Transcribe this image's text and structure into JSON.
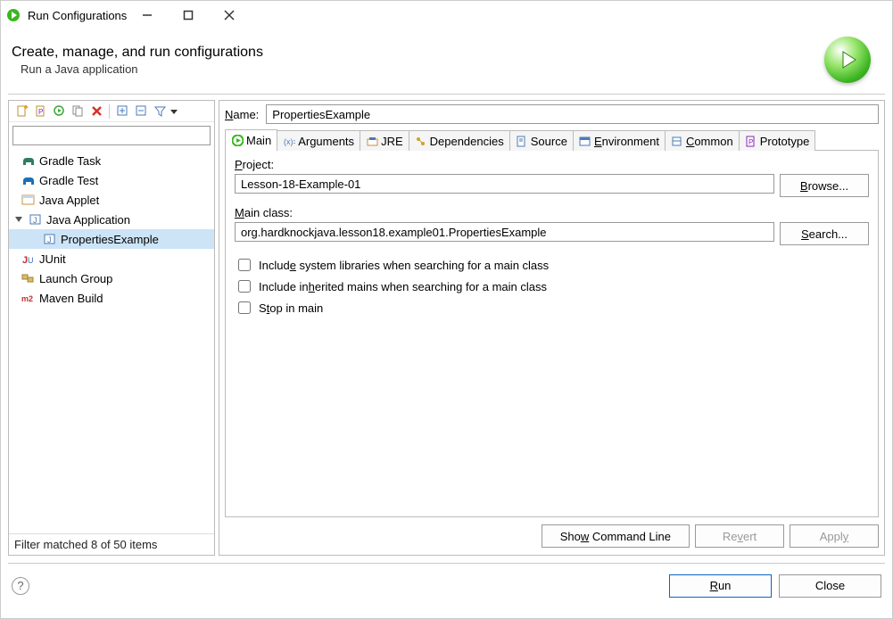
{
  "window": {
    "title": "Run Configurations"
  },
  "header": {
    "title": "Create, manage, and run configurations",
    "subtitle": "Run a Java application"
  },
  "toolbar_icons": [
    "new",
    "new-proto",
    "export",
    "duplicate",
    "delete",
    "expand",
    "collapse",
    "filter-dropdown"
  ],
  "filter_matched": "Filter matched 8 of 50 items",
  "tree": [
    {
      "label": "Gradle Task",
      "icon": "elephant-green"
    },
    {
      "label": "Gradle Test",
      "icon": "elephant-blue"
    },
    {
      "label": "Java Applet",
      "icon": "applet"
    },
    {
      "label": "Java Application",
      "icon": "java-app",
      "expanded": true,
      "children": [
        {
          "label": "PropertiesExample",
          "icon": "java-app",
          "selected": true
        }
      ]
    },
    {
      "label": "JUnit",
      "icon": "junit"
    },
    {
      "label": "Launch Group",
      "icon": "launch-group"
    },
    {
      "label": "Maven Build",
      "icon": "maven"
    }
  ],
  "config": {
    "name_label": "Name:",
    "name_value": "PropertiesExample"
  },
  "tabs": [
    {
      "label": "Main",
      "icon": "run-green",
      "active": true
    },
    {
      "label": "Arguments",
      "icon": "args"
    },
    {
      "label": "JRE",
      "icon": "jre"
    },
    {
      "label": "Dependencies",
      "icon": "deps"
    },
    {
      "label": "Source",
      "icon": "source"
    },
    {
      "label": "Environment",
      "icon": "env"
    },
    {
      "label": "Common",
      "icon": "common"
    },
    {
      "label": "Prototype",
      "icon": "proto"
    }
  ],
  "main_tab": {
    "project_label": "Project:",
    "project_value": "Lesson-18-Example-01",
    "browse_label": "Browse...",
    "main_class_label": "Main class:",
    "main_class_value": "org.hardknockjava.lesson18.example01.PropertiesExample",
    "search_label": "Search...",
    "cb_system": "Include system libraries when searching for a main class",
    "cb_inherited": "Include inherited mains when searching for a main class",
    "cb_stop": "Stop in main"
  },
  "buttons": {
    "show_cmd": "Show Command Line",
    "revert": "Revert",
    "apply": "Apply",
    "run": "Run",
    "close": "Close"
  }
}
